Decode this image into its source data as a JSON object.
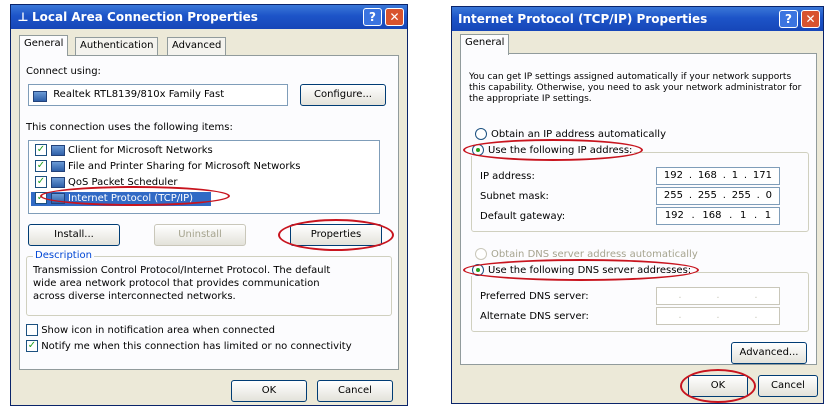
{
  "dialog1": {
    "title": "Local Area Connection Properties",
    "help_btn": "?",
    "close_btn": "✕",
    "tabs": [
      "General",
      "Authentication",
      "Advanced"
    ],
    "connect_using_label": "Connect using:",
    "adapter_name": "Realtek RTL8139/810x Family Fast",
    "configure_btn": "Configure...",
    "items_label": "This connection uses the following items:",
    "items": [
      {
        "label": "Client for Microsoft Networks",
        "checked": "✓"
      },
      {
        "label": "File and Printer Sharing for Microsoft Networks",
        "checked": "✓"
      },
      {
        "label": "QoS Packet Scheduler",
        "checked": "✓"
      },
      {
        "label": "Internet Protocol (TCP/IP)",
        "checked": "✓"
      }
    ],
    "install_btn": "Install...",
    "uninstall_btn": "Uninstall",
    "properties_btn": "Properties",
    "description_title": "Description",
    "description_lines": [
      "Transmission Control Protocol/Internet Protocol. The default",
      "wide area network protocol that provides communication",
      "across diverse interconnected networks."
    ],
    "show_icon_label": "Show icon in notification area when connected",
    "notify_label": "Notify me when this connection has limited or no connectivity",
    "notify_checked": "✓",
    "ok_btn": "OK",
    "cancel_btn": "Cancel"
  },
  "dialog2": {
    "title": "Internet Protocol (TCP/IP) Properties",
    "help_btn": "?",
    "close_btn": "✕",
    "tab": "General",
    "info_lines": [
      "You can get IP settings assigned automatically if your network supports",
      "this capability. Otherwise, you need to ask your network administrator for",
      "the appropriate IP settings."
    ],
    "obtain_ip_auto": "Obtain an IP address automatically",
    "use_following_ip": "Use the following IP address:",
    "ip_label": "IP address:",
    "ip_value": [
      "192",
      "168",
      "1",
      "171"
    ],
    "subnet_label": "Subnet mask:",
    "subnet_value": [
      "255",
      "255",
      "255",
      "0"
    ],
    "gateway_label": "Default gateway:",
    "gateway_value": [
      "192",
      "168",
      "1",
      "1"
    ],
    "obtain_dns_auto": "Obtain DNS server address automatically",
    "use_following_dns": "Use the following DNS server addresses:",
    "preferred_dns_label": "Preferred DNS server:",
    "alternate_dns_label": "Alternate DNS server:",
    "advanced_btn": "Advanced...",
    "ok_btn": "OK",
    "cancel_btn": "Cancel"
  },
  "colors": {
    "titlebar": "#1d54c8",
    "highlight_ellipse": "#c8141e",
    "dialog_bg": "#ece9d8"
  }
}
